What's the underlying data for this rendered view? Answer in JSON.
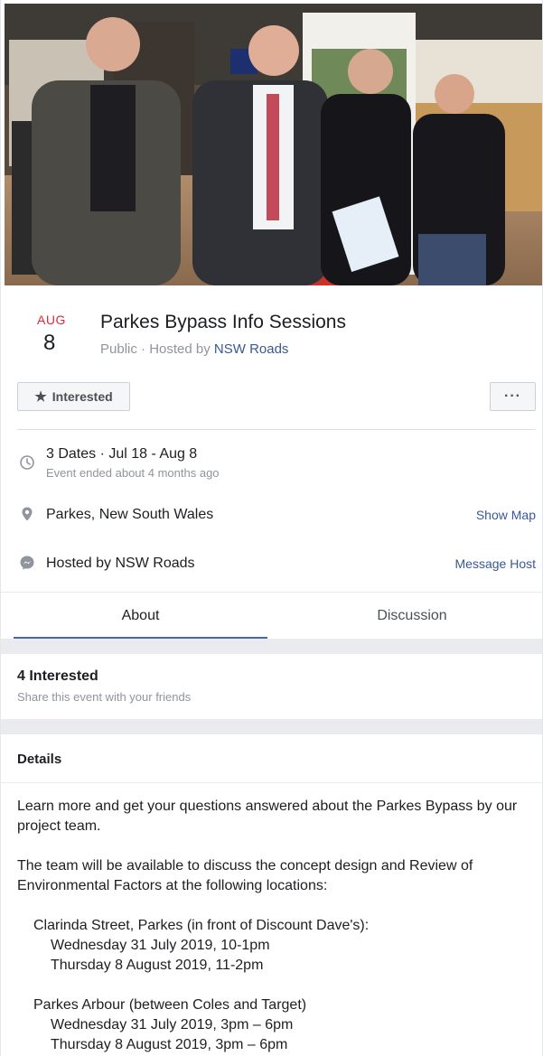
{
  "event": {
    "month": "AUG",
    "day": "8",
    "title": "Parkes Bypass Info Sessions",
    "privacy": "Public",
    "hosted_prefix": "· Hosted by",
    "host_name": "NSW Roads"
  },
  "actions": {
    "interested_label": "Interested",
    "more_label": "···"
  },
  "info": {
    "dates_main": "3 Dates · Jul 18 - Aug 8",
    "dates_sub": "Event ended about 4 months ago",
    "location": "Parkes, New South Wales",
    "show_map": "Show Map",
    "hosted": "Hosted by NSW Roads",
    "message_host": "Message Host"
  },
  "tabs": [
    {
      "label": "About"
    },
    {
      "label": "Discussion"
    }
  ],
  "interested": {
    "count": "4 Interested",
    "share": "Share this event with your friends"
  },
  "details": {
    "title": "Details",
    "intro": "Learn more and get your questions answered about the Parkes Bypass by our project team.",
    "team": "The team will be available to discuss the concept design and Review of Environmental Factors at the following locations:",
    "locations": [
      {
        "name": "Clarinda Street, Parkes (in front of Discount Dave's):",
        "times": [
          "Wednesday 31 July 2019, 10-1pm",
          "Thursday 8 August 2019, 11-2pm"
        ]
      },
      {
        "name": "Parkes Arbour (between Coles and Target)",
        "times": [
          "Wednesday 31 July 2019, 3pm – 6pm",
          "Thursday 8 August 2019, 3pm – 6pm"
        ]
      }
    ]
  },
  "colors": {
    "accent": "#4267b2",
    "link": "#385898",
    "month_red": "#e4253c",
    "muted": "#90949c"
  }
}
